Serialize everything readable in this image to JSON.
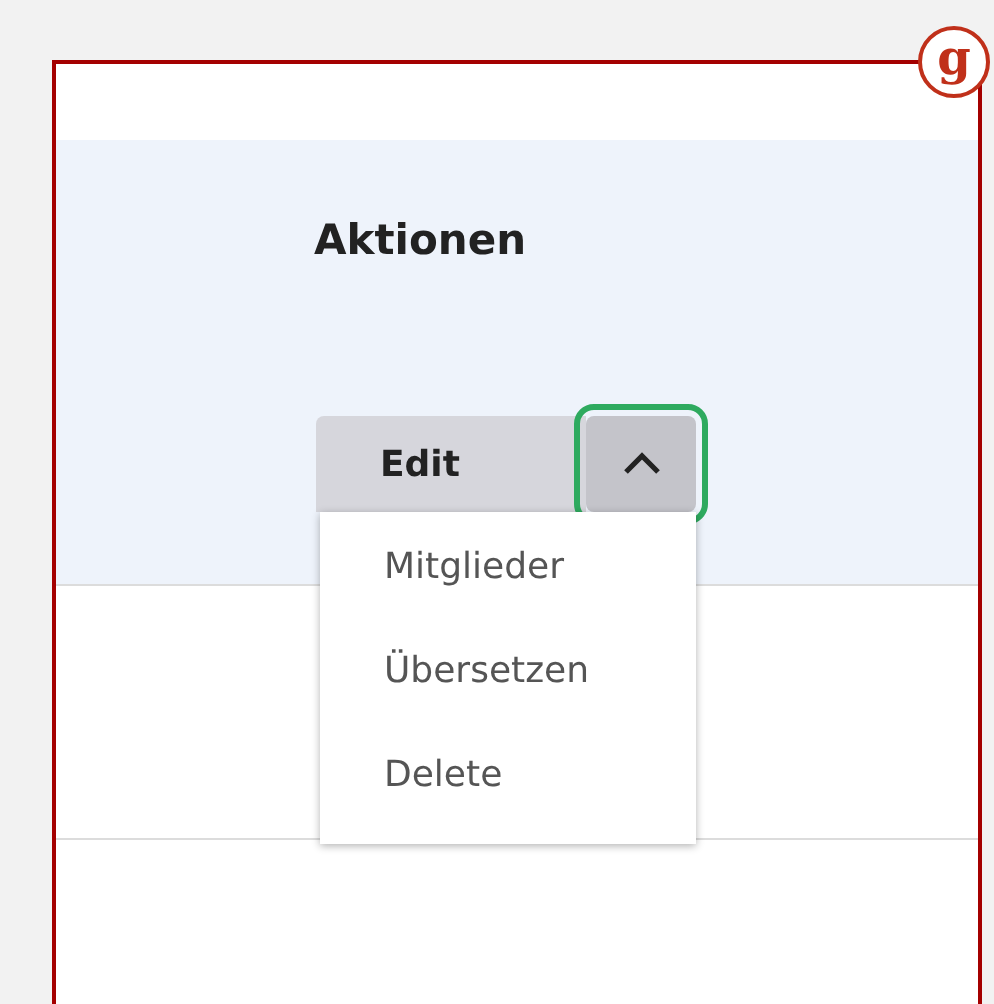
{
  "badge": "g",
  "column_header": "Aktionen",
  "split_button": {
    "label": "Edit",
    "expanded": true,
    "focused": true
  },
  "menu": {
    "items": [
      {
        "label": "Mitglieder"
      },
      {
        "label": "Übersetzen"
      },
      {
        "label": "Delete"
      }
    ]
  }
}
